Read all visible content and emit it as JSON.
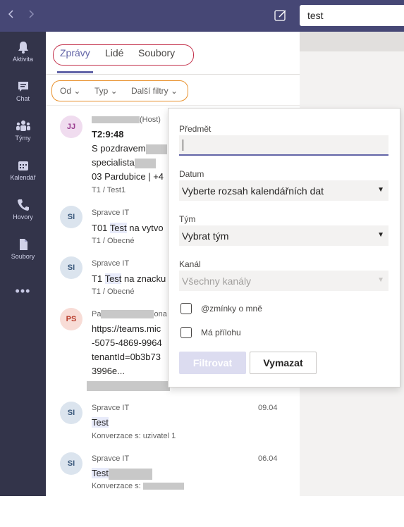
{
  "topbar": {
    "back_icon": "chevron-left-icon",
    "forward_icon": "chevron-right-icon",
    "compose_icon": "compose-icon",
    "search_value": "test"
  },
  "rail": {
    "items": [
      {
        "label": "Aktivita",
        "icon": "bell-icon"
      },
      {
        "label": "Chat",
        "icon": "chat-icon"
      },
      {
        "label": "Týmy",
        "icon": "teams-icon"
      },
      {
        "label": "Kalendář",
        "icon": "calendar-icon"
      },
      {
        "label": "Hovory",
        "icon": "phone-icon"
      },
      {
        "label": "Soubory",
        "icon": "file-icon"
      }
    ],
    "more": "•••"
  },
  "tabs": [
    {
      "label": "Zprávy",
      "active": true
    },
    {
      "label": "Lidé",
      "active": false
    },
    {
      "label": "Soubory",
      "active": false
    }
  ],
  "filters": [
    "Od",
    "Typ",
    "Další filtry"
  ],
  "messages": [
    {
      "initials": "JJ",
      "sender_suffix": "(Host)",
      "lines": [
        "T2:9:48",
        "S pozdravem",
        "specialista",
        "03 Pardubice | +4"
      ],
      "meta": "T1 / Test1",
      "date": ""
    },
    {
      "initials": "SI",
      "sender": "Spravce IT",
      "line_prefix": "T01 ",
      "highlight": "Test",
      "line_suffix": " na vytvo",
      "meta": "T1 / Obecné",
      "date": ""
    },
    {
      "initials": "SI",
      "sender": "Spravce IT",
      "line_prefix": "T1 ",
      "highlight": "Test",
      "line_suffix": " na znacku",
      "meta": "T1 / Obecné",
      "date": ""
    },
    {
      "initials": "PS",
      "sender_prefix": "Pa",
      "sender_suffix": "ona",
      "lines": [
        "https://teams.mic",
        "-5075-4869-9964",
        "tenantId=0b3b73",
        "3996e..."
      ],
      "date": ""
    },
    {
      "initials": "SI",
      "sender": "Spravce IT",
      "highlight": "Test",
      "meta": "Konverzace s: uzivatel 1",
      "date": "09.04"
    },
    {
      "initials": "SI",
      "sender": "Spravce IT",
      "highlight": "Test",
      "meta": "Konverzace s:",
      "date": "06.04"
    }
  ],
  "popup": {
    "subject_label": "Předmět",
    "subject_value": "",
    "date_label": "Datum",
    "date_value": "Vyberte rozsah kalendářních dat",
    "team_label": "Tým",
    "team_value": "Vybrat tým",
    "channel_label": "Kanál",
    "channel_value": "Všechny kanály",
    "mentions_label": "@zmínky o mně",
    "attachment_label": "Má přílohu",
    "filter_button": "Filtrovat",
    "clear_button": "Vymazat"
  },
  "colors": {
    "topbar": "#464775",
    "rail": "#33344a",
    "accent": "#6264a7"
  }
}
